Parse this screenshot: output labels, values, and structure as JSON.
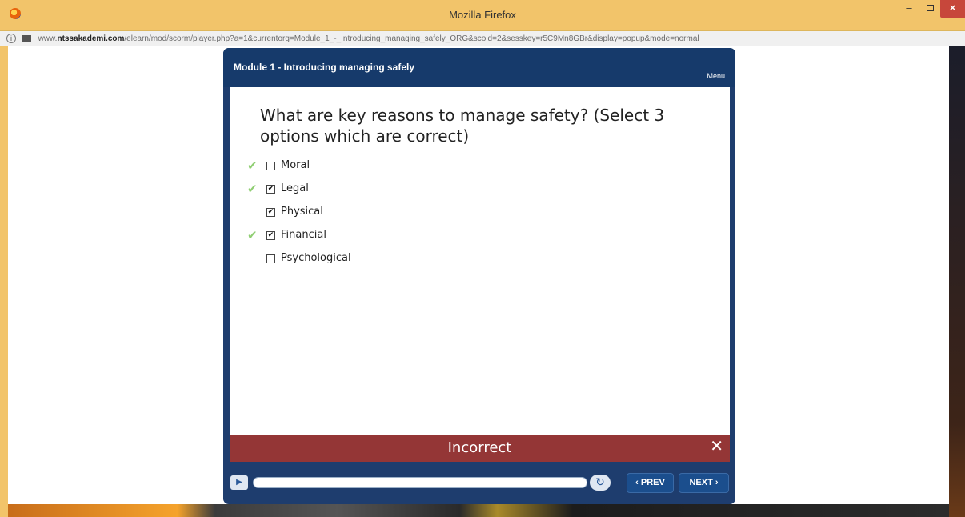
{
  "window": {
    "title": "Mozilla Firefox",
    "minimize": "–",
    "close": "×"
  },
  "urlbar": {
    "info": "i",
    "domain_prefix": "www.",
    "domain": "ntssakademi.com",
    "path": "/elearn/mod/scorm/player.php?a=1&currentorg=Module_1_-_Introducing_managing_safely_ORG&scoid=2&sesskey=r5C9Mn8GBr&display=popup&mode=normal"
  },
  "player": {
    "module_title": "Module 1 - Introducing managing safely",
    "menu_label": "Menu",
    "question": "What are key reasons to manage safety? (Select 3 options which are correct)",
    "options": [
      {
        "label": "Moral",
        "checked": false,
        "correct_mark": true
      },
      {
        "label": "Legal",
        "checked": true,
        "correct_mark": true
      },
      {
        "label": "Physical",
        "checked": true,
        "correct_mark": false
      },
      {
        "label": "Financial",
        "checked": true,
        "correct_mark": true
      },
      {
        "label": "Psychological",
        "checked": false,
        "correct_mark": false
      }
    ],
    "feedback": "Incorrect",
    "feedback_close": "✕",
    "progress_fraction": 0,
    "prev_label": "‹ PREV",
    "next_label": "NEXT ›",
    "play_icon": "▶",
    "replay_icon": "↻"
  },
  "colors": {
    "player_blue": "#1e3d6e",
    "incorrect_red": "#943636",
    "correct_green": "#8fce72"
  }
}
